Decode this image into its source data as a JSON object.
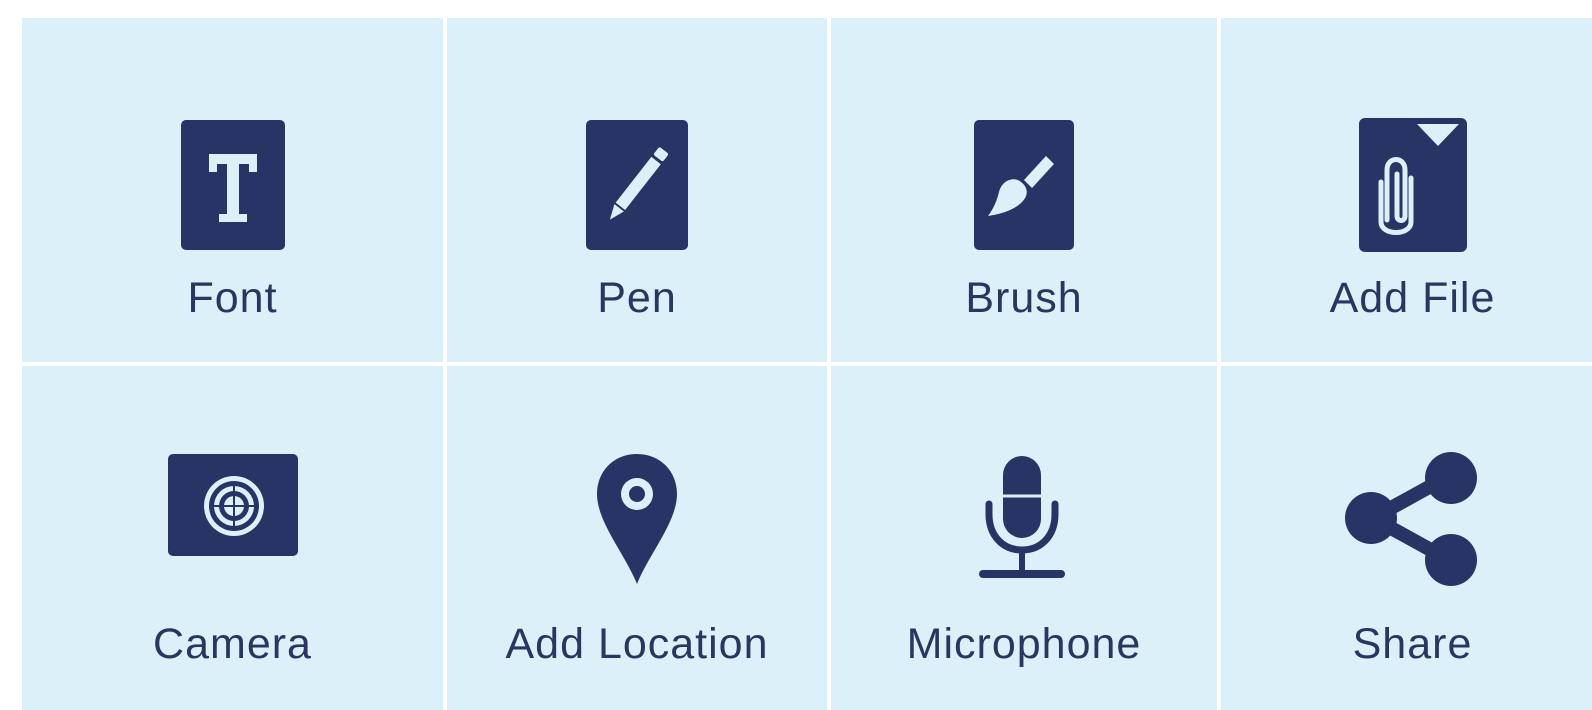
{
  "colors": {
    "tile_background": "#dcf0fa",
    "icon": "#283466",
    "label": "#2a3560",
    "gap": "#ffffff"
  },
  "tiles": [
    {
      "label": "Font",
      "icon": "font-icon"
    },
    {
      "label": "Pen",
      "icon": "pen-icon"
    },
    {
      "label": "Brush",
      "icon": "brush-icon"
    },
    {
      "label": "Add File",
      "icon": "add-file-icon"
    },
    {
      "label": "Camera",
      "icon": "camera-icon"
    },
    {
      "label": "Add Location",
      "icon": "location-pin-icon"
    },
    {
      "label": "Microphone",
      "icon": "microphone-icon"
    },
    {
      "label": "Share",
      "icon": "share-icon"
    }
  ]
}
